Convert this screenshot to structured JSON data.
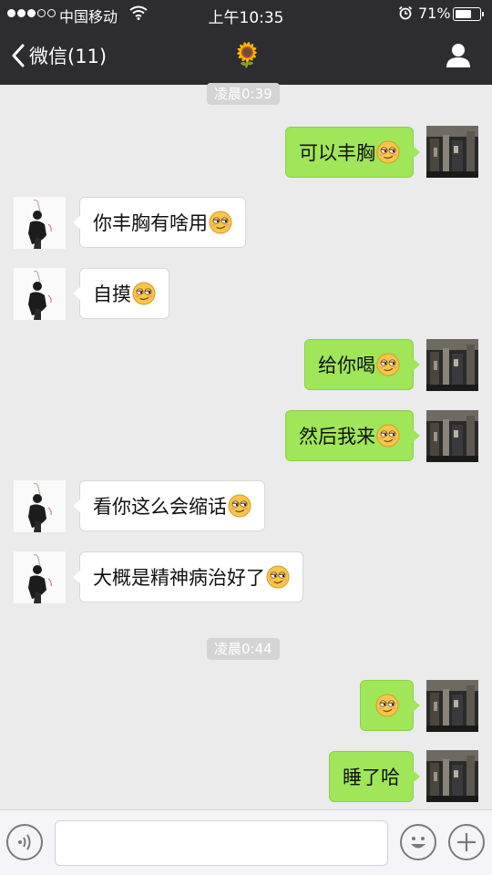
{
  "status_bar": {
    "carrier": "中国移动",
    "time": "上午10:35",
    "battery": "71%",
    "battery_level": 0.71,
    "signal_bars": 3,
    "icons": [
      "signal-icon",
      "wifi-icon",
      "alarm-icon",
      "battery-icon"
    ]
  },
  "nav": {
    "back_label": "微信(11)",
    "title_emoji": "🌻",
    "back_icon": "chevron-left-icon",
    "right_icon": "person-icon"
  },
  "chat": {
    "timestamps": [
      "凌晨0:39",
      "凌晨0:44"
    ],
    "messages": [
      {
        "side": "out",
        "text": "可以丰胸",
        "emoji": "smirk-emoji"
      },
      {
        "side": "in",
        "text": "你丰胸有啥用",
        "emoji": "smirk-emoji"
      },
      {
        "side": "in",
        "text": "自摸",
        "emoji": "smirk-emoji"
      },
      {
        "side": "out",
        "text": "给你喝",
        "emoji": "smirk-emoji"
      },
      {
        "side": "out",
        "text": "然后我来",
        "emoji": "smirk-emoji"
      },
      {
        "side": "in",
        "text": "看你这么会缩话",
        "emoji": "smirk-emoji"
      },
      {
        "side": "in",
        "text": "大概是精神病治好了",
        "emoji": "smirk-emoji"
      },
      {
        "side": "out",
        "text": "",
        "emoji": "smirk-emoji"
      },
      {
        "side": "out",
        "text": "睡了哈",
        "emoji": ""
      }
    ]
  },
  "input_bar": {
    "icons": [
      "voice-icon",
      "emoji-face-icon",
      "plus-icon"
    ],
    "text_value": ""
  },
  "colors": {
    "header": "#2c2c31",
    "chat_background": "#ebebeb",
    "outgoing_bubble": "#9fe658",
    "incoming_bubble": "#ffffff",
    "timestamp_pill": "#d4d4d4"
  }
}
